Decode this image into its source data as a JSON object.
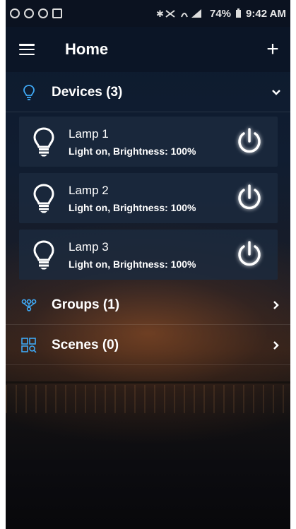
{
  "statusbar": {
    "battery": "74%",
    "time": "9:42 AM"
  },
  "appbar": {
    "title": "Home",
    "add_label": "+"
  },
  "sections": {
    "devices": {
      "label": "Devices (3)",
      "icon": "bulb-outline-icon",
      "chevron": "chevron-down-icon"
    },
    "groups": {
      "label": "Groups (1)",
      "icon": "groups-icon",
      "chevron": "chevron-right-icon"
    },
    "scenes": {
      "label": "Scenes (0)",
      "icon": "scenes-icon",
      "chevron": "chevron-right-icon"
    }
  },
  "devices": [
    {
      "name": "Lamp 1",
      "status": "Light on, Brightness: 100%"
    },
    {
      "name": "Lamp 2",
      "status": "Light on, Brightness: 100%"
    },
    {
      "name": "Lamp 3",
      "status": "Light on, Brightness: 100%"
    }
  ],
  "colors": {
    "accent": "#3fa9f5",
    "appbar": "#0b1526",
    "card": "#1c2a3e"
  }
}
